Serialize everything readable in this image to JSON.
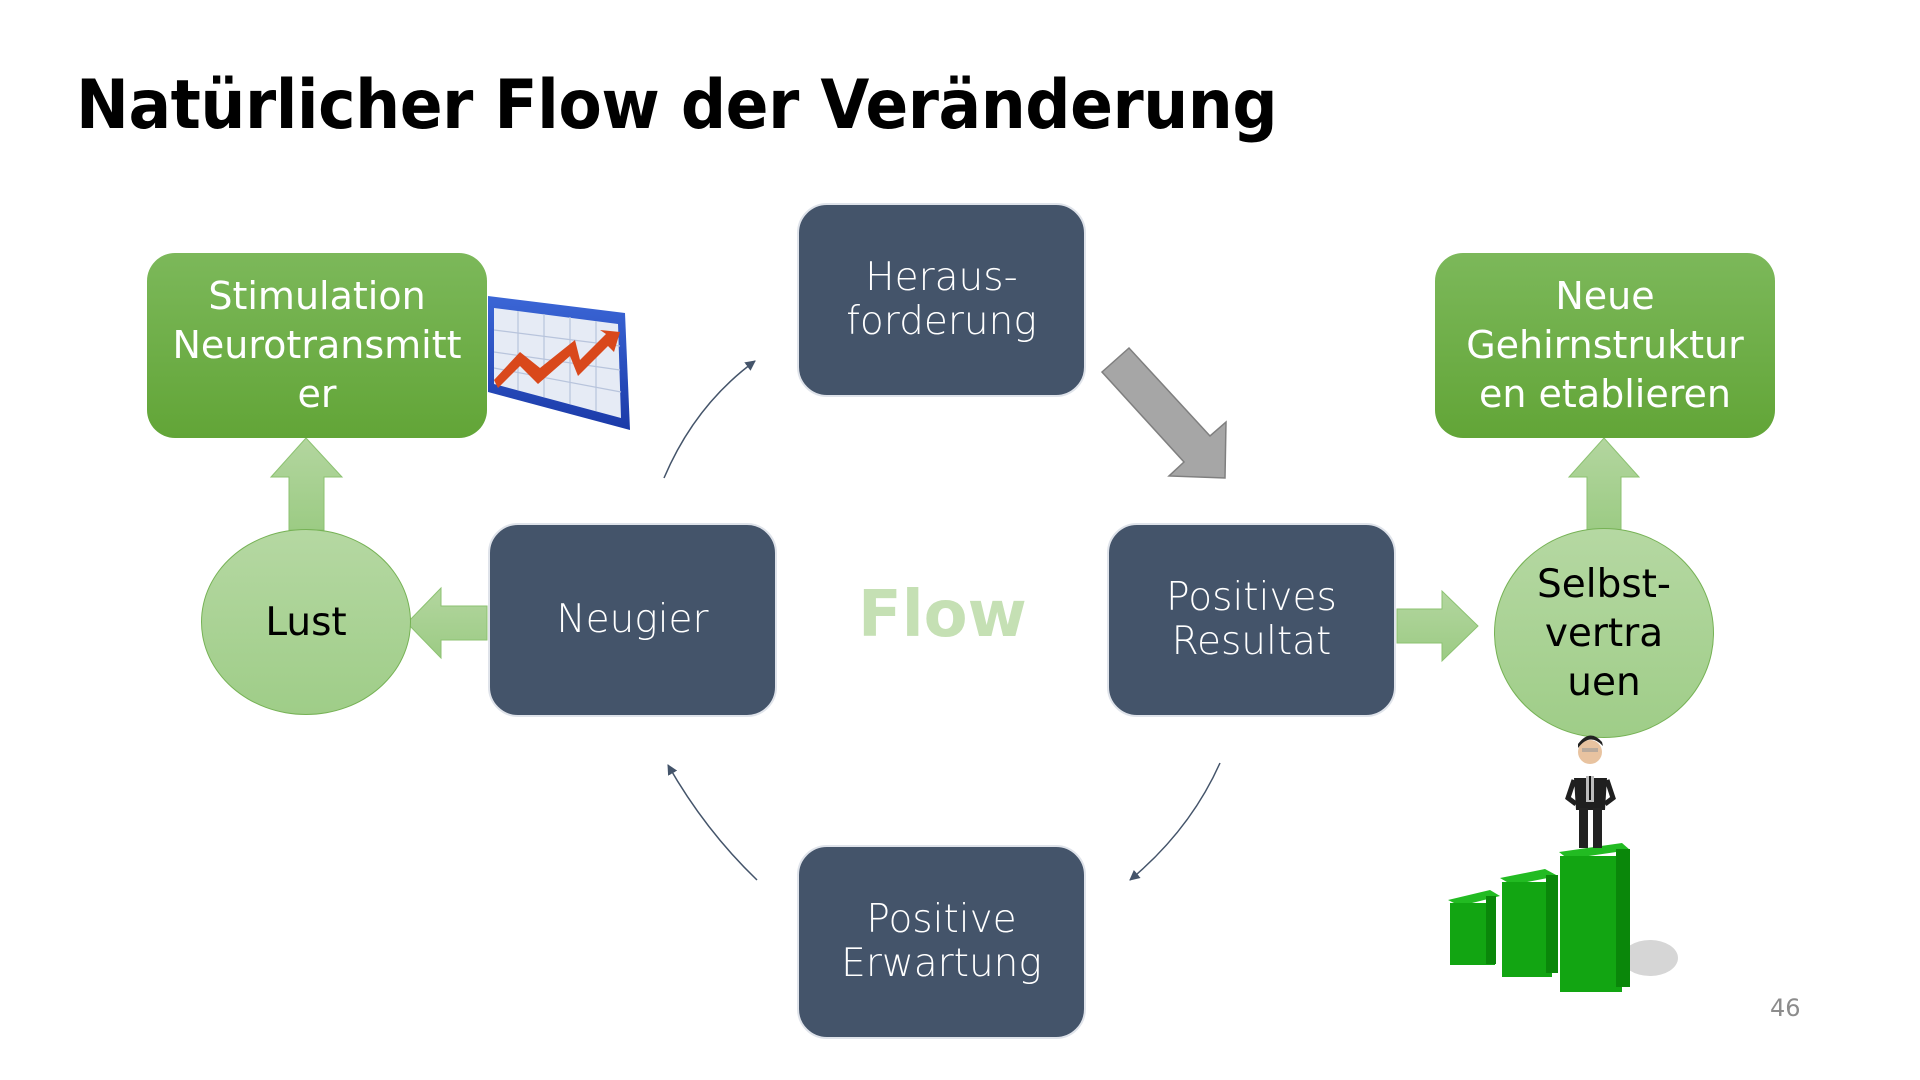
{
  "slide": {
    "title": "Natürlicher Flow der Veränderung",
    "page_number": "46",
    "center_label": "Flow"
  },
  "cycle_nodes": {
    "herausforderung": {
      "line1": "Heraus-",
      "line2": "forderung"
    },
    "positives_resultat": {
      "line1": "Positives",
      "line2": "Resultat"
    },
    "positive_erwartung": {
      "line1": "Positive",
      "line2": "Erwartung"
    },
    "neugier": {
      "line1": "Neugier"
    }
  },
  "left_branch": {
    "circle": "Lust",
    "box": {
      "line1": "Stimulation",
      "line2": "Neurotransmitt",
      "line3": "er"
    }
  },
  "right_branch": {
    "circle": {
      "line1": "Selbst-",
      "line2": "vertra",
      "line3": "uen"
    },
    "box": {
      "line1": "Neue",
      "line2": "Gehirnstruktur",
      "line3": "en etablieren"
    }
  },
  "icons": {
    "left": "rising-chart-icon",
    "right": "businessman-on-bar-chart-icon"
  },
  "colors": {
    "dark_box": "#44546a",
    "green_box": "#70ad47",
    "light_green": "#a9d18e",
    "flow_text": "#c5e0b4",
    "gray_arrow": "#a6a6a6"
  }
}
